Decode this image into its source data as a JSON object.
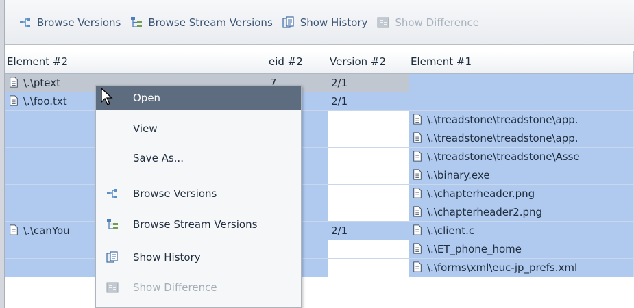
{
  "toolbar": {
    "browse_versions": "Browse Versions",
    "browse_stream_versions": "Browse Stream Versions",
    "show_history": "Show History",
    "show_difference": "Show Difference"
  },
  "columns": [
    "Element #2",
    "eid #2",
    "Version #2",
    "Element #1"
  ],
  "rows": [
    {
      "el2": "\\.\\ptext",
      "eid2": "7",
      "ver2": "2/1",
      "el1": ""
    },
    {
      "el2": "\\.\\foo.txt",
      "eid2": "",
      "ver2": "2/1",
      "el1": ""
    },
    {
      "el2": "",
      "eid2": "",
      "ver2": "",
      "el1": "\\.\\treadstone\\treadstone\\app."
    },
    {
      "el2": "",
      "eid2": "",
      "ver2": "",
      "el1": "\\.\\treadstone\\treadstone\\app."
    },
    {
      "el2": "",
      "eid2": "",
      "ver2": "",
      "el1": "\\.\\treadstone\\treadstone\\Asse"
    },
    {
      "el2": "",
      "eid2": "",
      "ver2": "",
      "el1": "\\.\\binary.exe"
    },
    {
      "el2": "",
      "eid2": "",
      "ver2": "",
      "el1": "\\.\\chapterheader.png"
    },
    {
      "el2": "",
      "eid2": "",
      "ver2": "",
      "el1": "\\.\\chapterheader2.png"
    },
    {
      "el2": "\\.\\canYou",
      "eid2": "",
      "ver2": "2/1",
      "el1": "\\.\\client.c"
    },
    {
      "el2": "",
      "eid2": "",
      "ver2": "",
      "el1": "\\.\\ET_phone_home"
    },
    {
      "el2": "",
      "eid2": "",
      "ver2": "",
      "el1": "\\.\\forms\\xml\\euc-jp_prefs.xml"
    }
  ],
  "context_menu": {
    "open": "Open",
    "view": "View",
    "save_as": "Save As...",
    "browse_versions": "Browse Versions",
    "browse_stream_versions": "Browse Stream Versions",
    "show_history": "Show History",
    "show_difference": "Show Difference"
  },
  "colors": {
    "row_selected": "#afc9ef",
    "row_focused": "#c0c7d0",
    "menu_highlight": "#5d6c7e",
    "toolbar_text": "#3a5573",
    "disabled_text": "#a9b3be"
  },
  "icons": {
    "browse_versions": "tree-branch-icon",
    "browse_stream_versions": "stream-tree-icon",
    "show_history": "history-icon",
    "show_difference": "difference-icon",
    "file": "file-icon",
    "cursor": "mouse-pointer-icon"
  }
}
